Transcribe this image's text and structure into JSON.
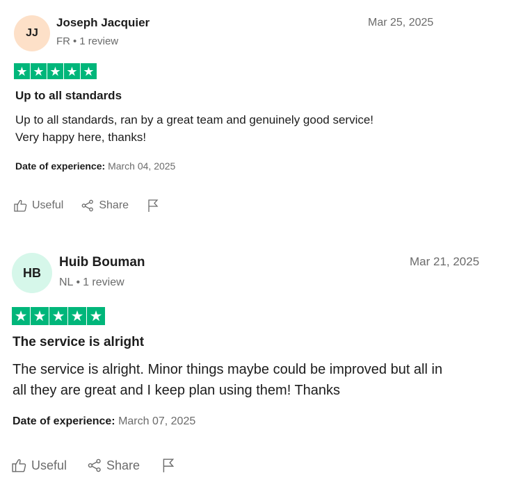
{
  "reviews": [
    {
      "initials": "JJ",
      "avatar_color": "#fde0c8",
      "name": "Joseph Jacquier",
      "country": "FR",
      "review_count": "1 review",
      "date": "Mar 25, 2025",
      "rating": 5,
      "title": "Up to all standards",
      "body_lines": [
        "Up to all standards, ran by a great team and genuinely good service!",
        "Very happy here, thanks!"
      ],
      "experience_label": "Date of experience:",
      "experience_date": "March 04, 2025",
      "actions": {
        "useful": "Useful",
        "share": "Share"
      }
    },
    {
      "initials": "HB",
      "avatar_color": "#d6f7ea",
      "name": "Huib Bouman",
      "country": "NL",
      "review_count": "1 review",
      "date": "Mar 21, 2025",
      "rating": 5,
      "title": "The service is alright",
      "body_lines": [
        "The service is alright. Minor things maybe could be improved but all in",
        "all they are great and I keep plan using them! Thanks"
      ],
      "experience_label": "Date of experience:",
      "experience_date": "March 07, 2025",
      "actions": {
        "useful": "Useful",
        "share": "Share"
      }
    }
  ],
  "colors": {
    "star_green": "#00b67a",
    "muted_text": "#6b6b6b"
  },
  "icons": {
    "useful": "thumbs-up-icon",
    "share": "share-icon",
    "report": "flag-icon",
    "star": "star-icon"
  }
}
